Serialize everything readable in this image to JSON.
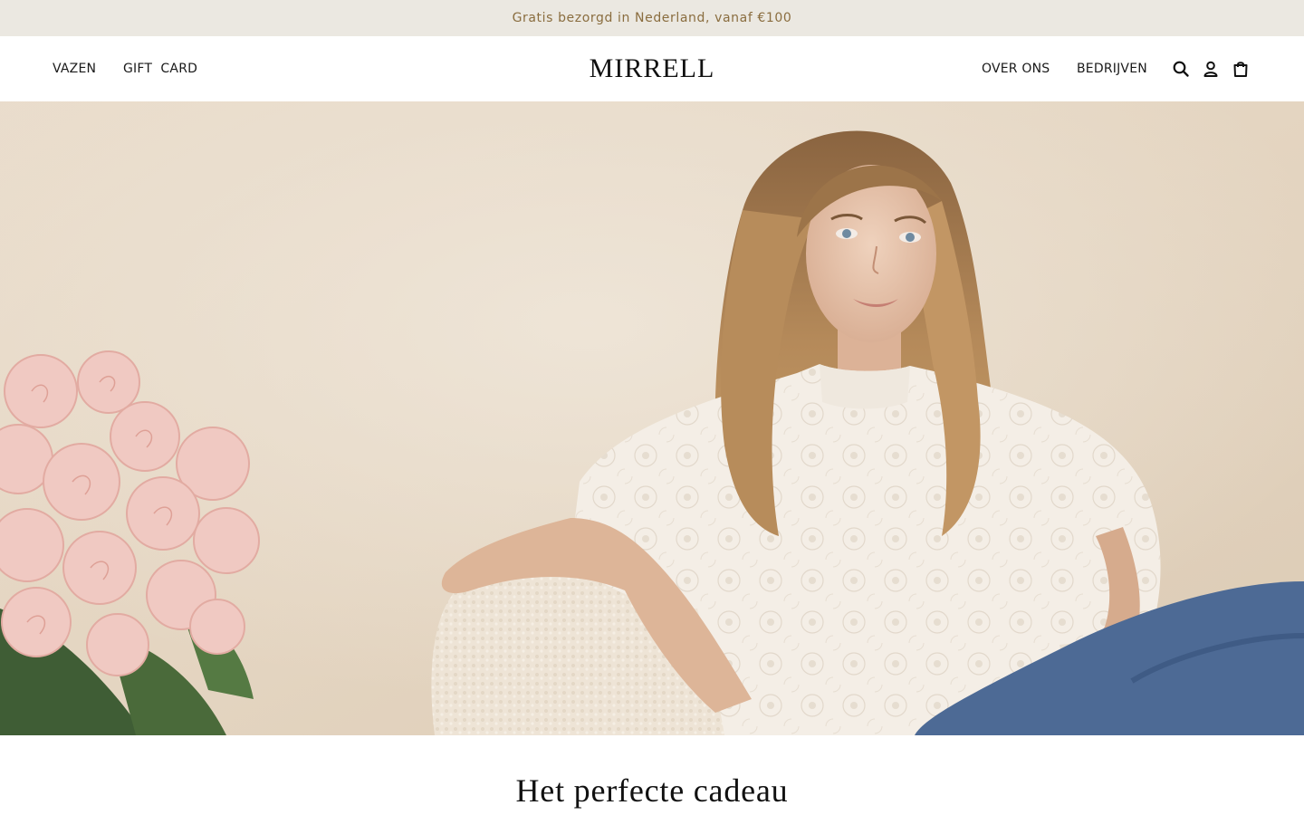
{
  "announcement": {
    "text": "Gratis bezorgd in Nederland, vanaf €100"
  },
  "header": {
    "logo": "MIRRELL",
    "nav_left": [
      {
        "label": "VAZEN"
      },
      {
        "label": "GIFT  CARD"
      }
    ],
    "nav_right": [
      {
        "label": "OVER ONS"
      },
      {
        "label": "BEDRIJVEN"
      }
    ],
    "icons": [
      "search-icon",
      "account-icon",
      "cart-icon"
    ]
  },
  "hero": {
    "image": "woman-with-roses-photo"
  },
  "section": {
    "title": "Het perfecte cadeau"
  },
  "colors": {
    "announcement_bg": "#ebe8e1",
    "announcement_text": "#8a6d3f",
    "text": "#1a1a1a"
  }
}
